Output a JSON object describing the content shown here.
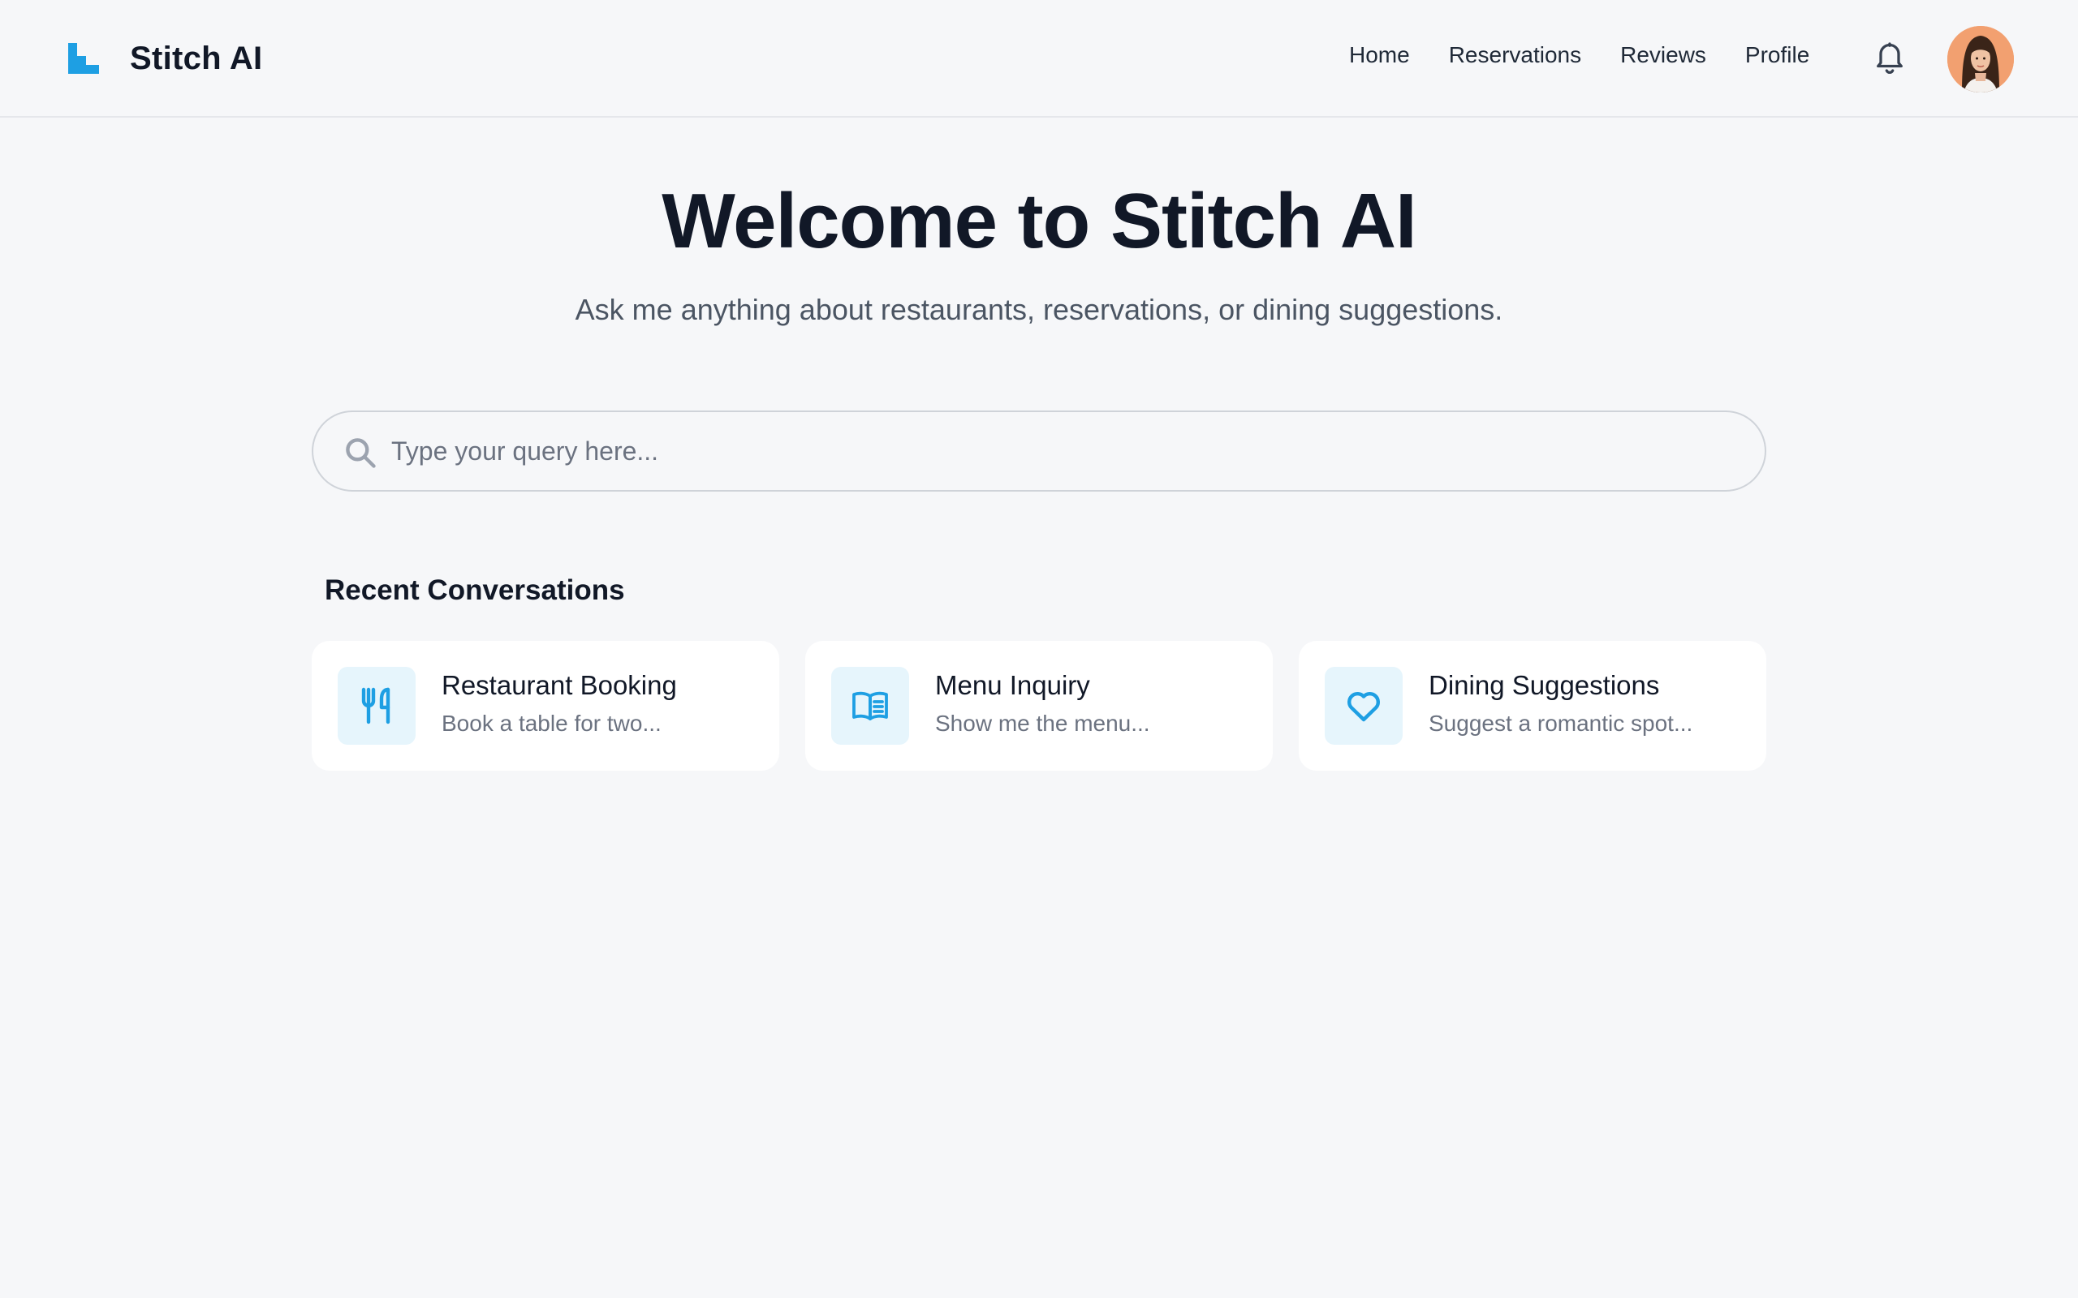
{
  "app": {
    "name": "Stitch AI",
    "logo_icon": "stitch-logo-icon",
    "accent": "#1e9fe3"
  },
  "nav": {
    "items": [
      {
        "label": "Home"
      },
      {
        "label": "Reservations"
      },
      {
        "label": "Reviews"
      },
      {
        "label": "Profile"
      }
    ],
    "notifications_icon": "bell-icon",
    "avatar_icon": "user-avatar"
  },
  "hero": {
    "title": "Welcome to Stitch AI",
    "subtitle": "Ask me anything about restaurants, reservations, or dining suggestions."
  },
  "search": {
    "placeholder": "Type your query here...",
    "value": "",
    "icon": "search-icon"
  },
  "recent": {
    "title": "Recent Conversations",
    "items": [
      {
        "title": "Restaurant Booking",
        "subtitle": "Book a table for two...",
        "icon": "utensils-icon"
      },
      {
        "title": "Menu Inquiry",
        "subtitle": "Show me the menu...",
        "icon": "menu-book-icon"
      },
      {
        "title": "Dining Suggestions",
        "subtitle": "Suggest a romantic spot...",
        "icon": "heart-icon"
      }
    ]
  }
}
